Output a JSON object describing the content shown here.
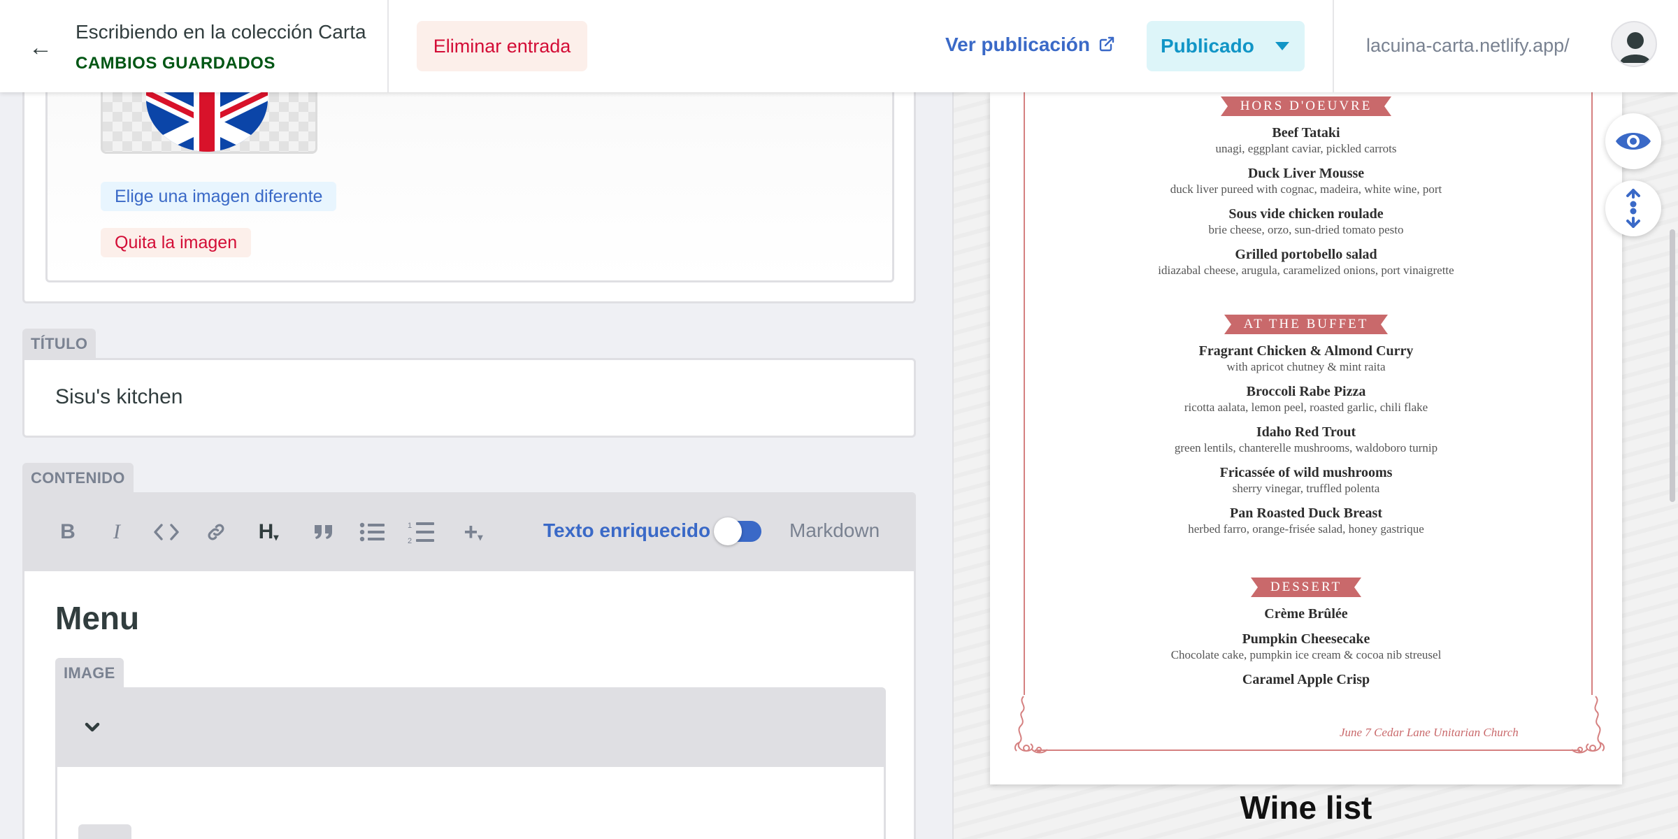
{
  "topbar": {
    "back_icon": "←",
    "collection_title": "Escribiendo en la colección Carta",
    "status": "CAMBIOS GUARDADOS",
    "delete_label": "Eliminar entrada",
    "view_label": "Ver publicación",
    "publish_label": "Publicado",
    "site_url": "lacuina-carta.netlify.app/",
    "colors": {
      "accent": "#3a69c7",
      "saved": "#005614",
      "danger": "#d30d36",
      "publish": "#1195c6"
    }
  },
  "editor": {
    "image_widget": {
      "choose_label": "Elige una imagen diferente",
      "remove_label": "Quita la imagen",
      "thumbnail_icon": "uk-flag-icon"
    },
    "title_field": {
      "label": "TÍTULO",
      "value": "Sisu's kitchen"
    },
    "content_field": {
      "label": "CONTENIDO",
      "toolbar": {
        "bold": "B",
        "italic": "I",
        "code": "<>",
        "heading": "H",
        "plus": "+",
        "rich_label": "Texto enriquecido",
        "markdown_label": "Markdown",
        "rich_text_enabled": true
      },
      "heading": "Menu",
      "image_block_label": "IMAGE"
    }
  },
  "preview": {
    "sections": [
      {
        "title": "HORS D'OEUVRE",
        "items": [
          {
            "name": "Beef Tataki",
            "desc": "unagi, eggplant caviar, pickled carrots"
          },
          {
            "name": "Duck Liver Mousse",
            "desc": "duck liver pureed with cognac, madeira, white wine, port"
          },
          {
            "name": "Sous vide chicken roulade",
            "desc": "brie cheese, orzo, sun-dried tomato pesto"
          },
          {
            "name": "Grilled portobello salad",
            "desc": "idiazabal cheese, arugula, caramelized onions, port vinaigrette"
          }
        ]
      },
      {
        "title": "AT THE BUFFET",
        "items": [
          {
            "name": "Fragrant Chicken & Almond Curry",
            "desc": "with apricot chutney & mint raita"
          },
          {
            "name": "Broccoli Rabe Pizza",
            "desc": "ricotta aalata, lemon peel, roasted garlic, chili flake"
          },
          {
            "name": "Idaho Red Trout",
            "desc": "green lentils, chanterelle mushrooms, waldoboro turnip"
          },
          {
            "name": "Fricassée of wild mushrooms",
            "desc": "sherry vinegar, truffled polenta"
          },
          {
            "name": "Pan Roasted Duck Breast",
            "desc": "herbed farro, orange-frisée salad, honey gastrique"
          }
        ]
      },
      {
        "title": "DESSERT",
        "items": [
          {
            "name": "Crème Brûlée",
            "desc": ""
          },
          {
            "name": "Pumpkin Cheesecake",
            "desc": "Chocolate cake, pumpkin ice cream & cocoa nib streusel"
          },
          {
            "name": "Caramel Apple Crisp",
            "desc": ""
          }
        ]
      }
    ],
    "footer": "June 7 Cedar Lane Unitarian Church",
    "next_heading": "Wine list",
    "menu_accent": "#c9696b"
  }
}
